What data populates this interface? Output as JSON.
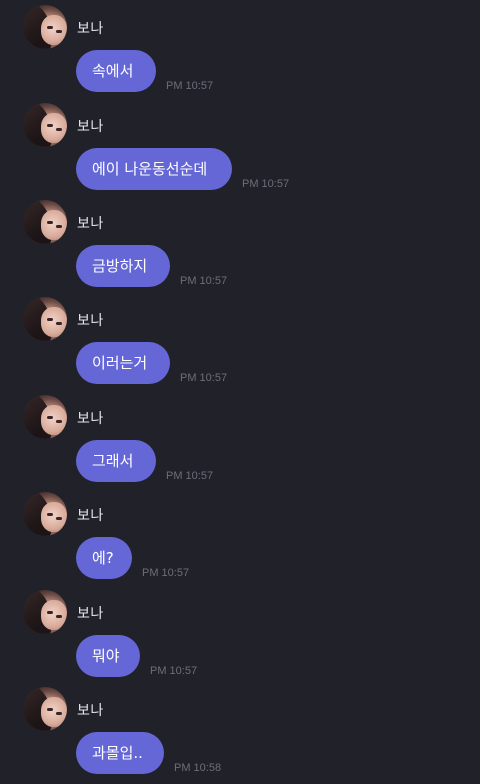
{
  "chat": {
    "sender_name": "보나",
    "messages": [
      {
        "text": "속에서",
        "time": "PM 10:57"
      },
      {
        "text": "에이 나운동선순데",
        "time": "PM 10:57"
      },
      {
        "text": "금방하지",
        "time": "PM 10:57"
      },
      {
        "text": "이러는거",
        "time": "PM 10:57"
      },
      {
        "text": "그래서",
        "time": "PM 10:57"
      },
      {
        "text": "에?",
        "time": "PM 10:57"
      },
      {
        "text": "뭐야",
        "time": "PM 10:57"
      },
      {
        "text": "과몰입..",
        "time": "PM 10:58"
      }
    ]
  },
  "colors": {
    "background": "#212129",
    "bubble": "#6567d6",
    "bubble_text": "#ffffff",
    "name_text": "#e6e6ea",
    "time_text": "#6e6e78"
  }
}
